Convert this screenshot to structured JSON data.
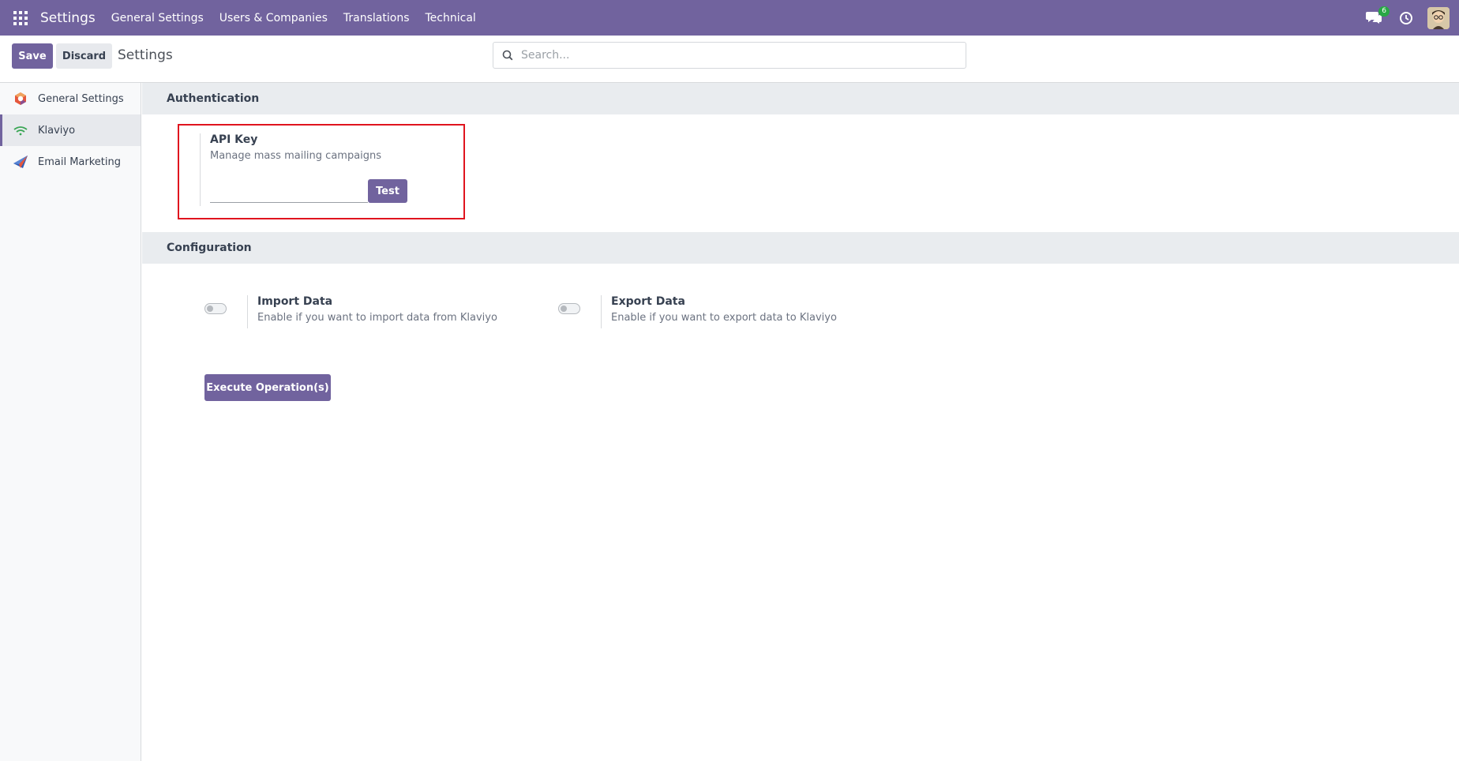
{
  "navbar": {
    "brand": "Settings",
    "menu": [
      "General Settings",
      "Users & Companies",
      "Translations",
      "Technical"
    ],
    "chat_count": "6",
    "accent_color": "#71639e"
  },
  "control": {
    "save_label": "Save",
    "discard_label": "Discard",
    "title": "Settings",
    "search_placeholder": "Search..."
  },
  "sidebar": {
    "items": [
      {
        "label": "General Settings",
        "icon": "odoo-logo-icon"
      },
      {
        "label": "Klaviyo",
        "icon": "klaviyo-icon",
        "active": true
      },
      {
        "label": "Email Marketing",
        "icon": "paper-plane-icon"
      }
    ]
  },
  "authentication": {
    "heading": "Authentication",
    "api_key_label": "API Key",
    "api_key_desc": "Manage mass mailing campaigns",
    "api_key_value": "",
    "test_label": "Test"
  },
  "configuration": {
    "heading": "Configuration",
    "import": {
      "label": "Import Data",
      "desc": "Enable if you want to import data from Klaviyo",
      "enabled": false
    },
    "export": {
      "label": "Export Data",
      "desc": "Enable if you want to export data to Klaviyo",
      "enabled": false
    },
    "execute_label": "Execute Operation(s)"
  }
}
